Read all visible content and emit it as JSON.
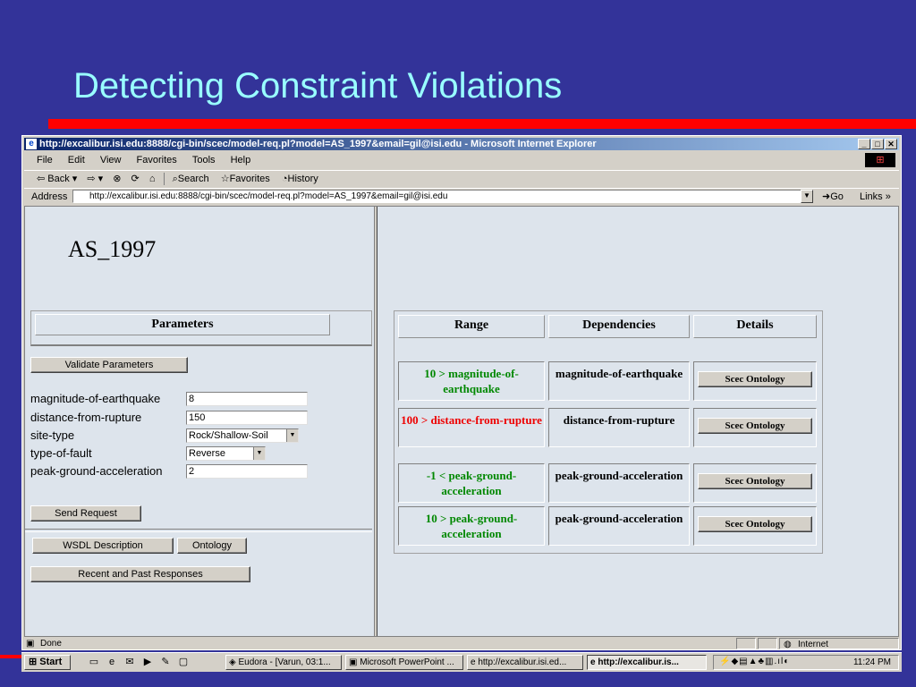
{
  "slide": {
    "title": "Detecting Constraint Violations",
    "accent_color": "#ff0000",
    "background_color": "#333399",
    "title_color": "#99ffff"
  },
  "window": {
    "title": "http://excalibur.isi.edu:8888/cgi-bin/scec/model-req.pl?model=AS_1997&email=gil@isi.edu - Microsoft Internet Explorer",
    "min_icon": "minimize-icon",
    "max_icon": "maximize-icon",
    "close_icon": "close-icon"
  },
  "menubar": {
    "items": [
      "File",
      "Edit",
      "View",
      "Favorites",
      "Tools",
      "Help"
    ]
  },
  "toolbar": {
    "back": "Back",
    "search": "Search",
    "favorites": "Favorites",
    "history": "History"
  },
  "address": {
    "label": "Address",
    "url": "http://excalibur.isi.edu:8888/cgi-bin/scec/model-req.pl?model=AS_1997&email=gil@isi.edu",
    "go": "Go",
    "links": "Links"
  },
  "left": {
    "model_name": "AS_1997",
    "params_header": "Parameters",
    "validate": "Validate Parameters",
    "params": [
      {
        "label": "magnitude-of-earthquake",
        "value": "8"
      },
      {
        "label": "distance-from-rupture",
        "value": "150"
      },
      {
        "label": "site-type",
        "value": "Rock/Shallow-Soil"
      },
      {
        "label": "type-of-fault",
        "value": "Reverse"
      },
      {
        "label": "peak-ground-acceleration",
        "value": "2"
      }
    ],
    "send": "Send Request",
    "wsdl": "WSDL Description",
    "ontology": "Ontology",
    "recent": "Recent and Past Responses"
  },
  "results": {
    "headers": [
      "Range",
      "Dependencies",
      "Details"
    ],
    "rows": [
      {
        "range": "10 > magnitude-of-earthquake",
        "status": "ok",
        "dependency": "magnitude-of-earthquake",
        "details": "Scec Ontology"
      },
      {
        "range": "100 > distance-from-rupture",
        "status": "violated",
        "dependency": "distance-from-rupture",
        "details": "Scec Ontology"
      },
      {
        "range": "-1 < peak-ground-acceleration",
        "status": "ok",
        "dependency": "peak-ground-acceleration",
        "details": "Scec Ontology"
      },
      {
        "range": "10 > peak-ground-acceleration",
        "status": "ok",
        "dependency": "peak-ground-acceleration",
        "details": "Scec Ontology"
      }
    ],
    "ok_color": "#008800",
    "violated_color": "#ee0000"
  },
  "status": {
    "text": "Done",
    "zone": "Internet"
  },
  "taskbar": {
    "start": "Start",
    "tasks": [
      {
        "label": "Eudora - [Varun, 03:1...",
        "active": false
      },
      {
        "label": "Microsoft PowerPoint ...",
        "active": false
      },
      {
        "label": "http://excalibur.isi.ed...",
        "active": false
      },
      {
        "label": "http://excalibur.is...",
        "active": true
      }
    ],
    "clock": "11:24 PM"
  }
}
